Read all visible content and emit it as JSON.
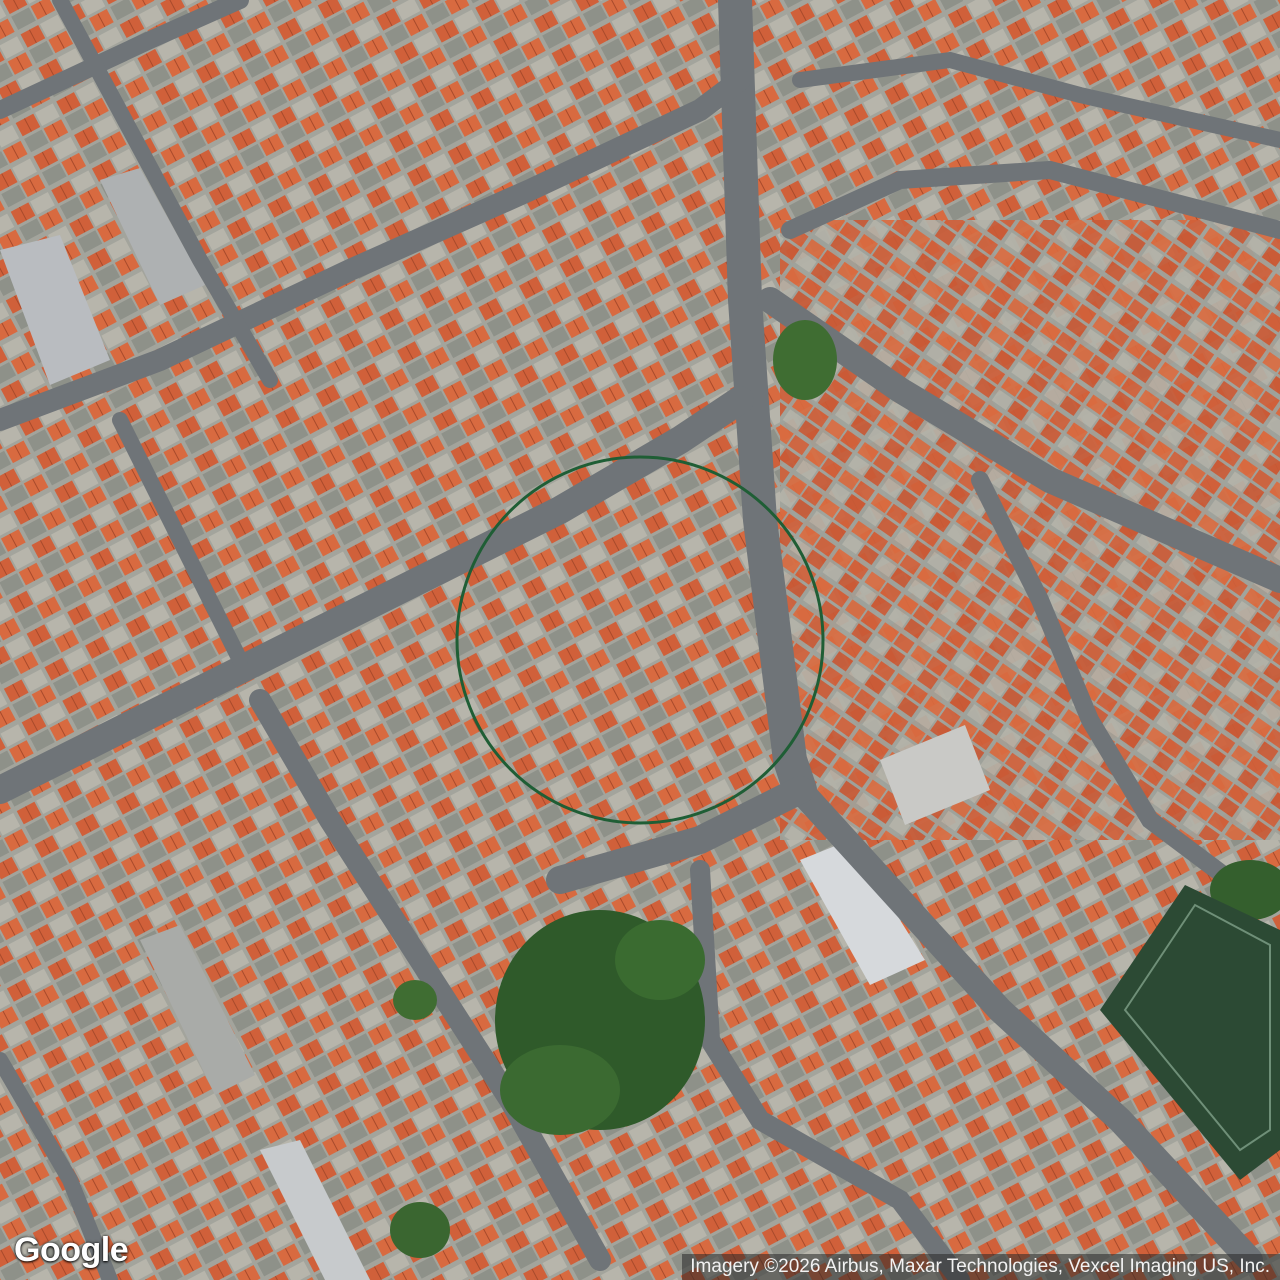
{
  "map": {
    "type": "satellite",
    "logo_text": "Google",
    "attribution": "Imagery ©2026 Airbus, Maxar Technologies, Vexcel Imaging US, Inc.",
    "marker": {
      "shape": "circle",
      "color": "#1f5e35"
    },
    "colors": {
      "roof_red": "#d4623b",
      "roof_grey": "#9ea19c",
      "road": "#6f7478",
      "vegetation": "#2f5a2a",
      "field": "#2c4a34"
    }
  }
}
